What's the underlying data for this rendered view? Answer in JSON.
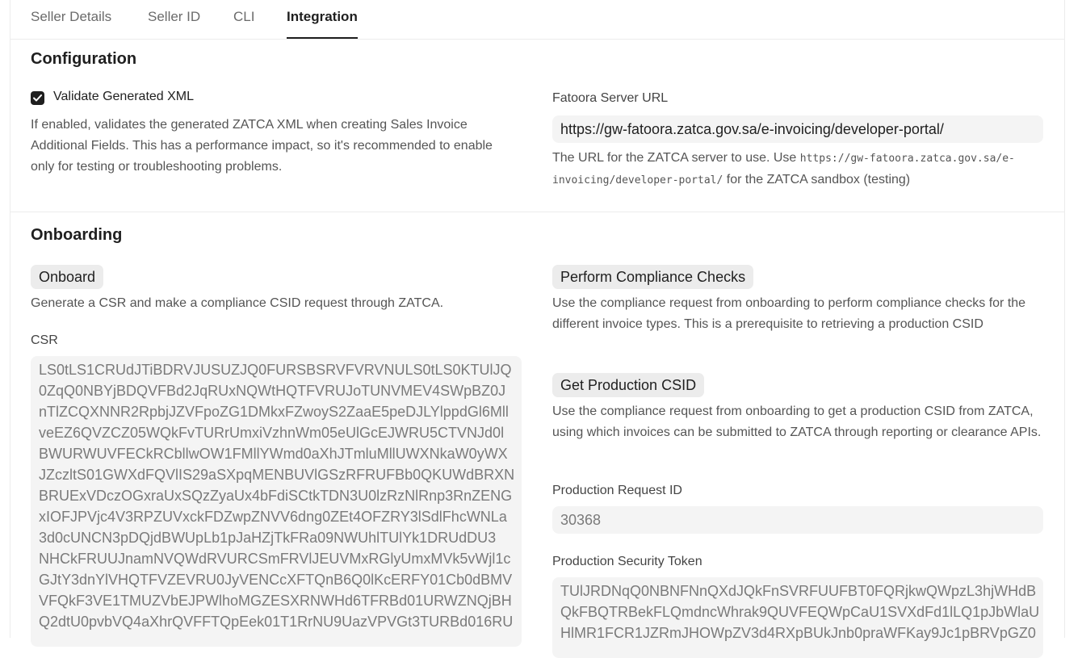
{
  "tabs": [
    {
      "label": "Seller Details"
    },
    {
      "label": "Seller ID"
    },
    {
      "label": "CLI"
    },
    {
      "label": "Integration",
      "active": true
    }
  ],
  "configuration": {
    "title": "Configuration",
    "validate_xml": {
      "label": "Validate Generated XML",
      "checked": true,
      "description": "If enabled, validates the generated ZATCA XML when creating Sales Invoice Additional Fields. This has a performance impact, so it's recommended to enable only for testing or troubleshooting problems."
    },
    "server_url": {
      "label": "Fatoora Server URL",
      "value": "https://gw-fatoora.zatca.gov.sa/e-invoicing/developer-portal/",
      "help_prefix": "The URL for the ZATCA server to use. Use ",
      "help_code_line1": "https://gw-fatoora.zatca.gov.sa/e-",
      "help_code_line2": "invoicing/developer-portal/",
      "help_suffix": " for the ZATCA sandbox (testing)"
    }
  },
  "onboarding": {
    "title": "Onboarding",
    "onboard_button": "Onboard",
    "onboard_description": "Generate a CSR and make a compliance CSID request through ZATCA.",
    "csr_label": "CSR",
    "csr_lines": [
      "LS0tLS1CRUdJTiBDRVJUSUZJQ0FURSBSRVFVRVNULS0tLS0KTUlJQ",
      "0ZqQ0NBYjBDQVFBd2JqRUxNQWtHQTFVRUJoTUNVMEV4SWpBZ0J",
      "nTlZCQXNNR2RpbjJZVFpoZG1DMkxFZwoyS2ZaaE5peDJLYlppdGl6Mll",
      "veEZ6QVZCZ05WQkFvTURrUmxiVzhnWm05eUlGcEJWRU5CTVNJd0l",
      "BWURWUVFECkRCbllwOW1FMllYWmd0aXhJTmluMllUWXNkaW0yWX",
      "JZczltS01GWXdFQVlIS29aSXpqMENBUVlGSzRFRUFBb0QKUWdBRXN",
      "BRUExVDczOGxraUxSQzZyaUx4bFdiSCtkTDN3U0lzRzNlRnp3RnZENG",
      "xIOFJPVjc4V3RPZUVxckFDZwpZNVV6dng0ZEt4OFZRY3lSdlFhcWNLa",
      "3d0cUNCN3pDQjdBWUpLb1pJaHZjTkFRa09NWUhlTUlYk1DRUdDU3",
      "NHCkFRUUJnamNVQWdRVURCSmFRVlJEUVMxRGlyUmxMVk5vWjl1c",
      "GJtY3dnYlVHQTFVZEVRU0JyVENCcXFTQnB6Q0lKcERFY01Cb0dBMV",
      "VFQkF3VE1TMUZVbEJPWlhoMGZESXRNWHd6TFRBd01URWZNQjBH",
      "Q2dtU0pvbVQ4aXhrQVFFTQpEek01T1RrNU9UazVPVGt3TURBd016RU"
    ],
    "compliance_button": "Perform Compliance Checks",
    "compliance_description": "Use the compliance request from onboarding to perform compliance checks for the different invoice types. This is a prerequisite to retrieving a production CSID",
    "production_button": "Get Production CSID",
    "production_description": "Use the compliance request from onboarding to get a production CSID from ZATCA, using which invoices can be submitted to ZATCA through reporting or clearance APIs.",
    "production_request_id_label": "Production Request ID",
    "production_request_id": "30368",
    "production_token_label": "Production Security Token",
    "production_token_lines": [
      "TUlJRDNqQ0NBNFNnQXdJQkFnSVRFUUFBT0FQRjkwQWpzL3hjWHdB",
      "QkFBQTRBekFLQmdncWhrak9QUVFEQWpCaU1SVXdFd1lLQ1pJbWlaU",
      "HlMR1FCR1JZRmJHOWpZV3d4RXpBUkJnb0praWFKay9Jc1pBRVpGZ0"
    ],
    "colors": {
      "accent": "#1f1f1f",
      "field_bg": "#f4f4f4",
      "pill_bg": "#ececec"
    }
  }
}
